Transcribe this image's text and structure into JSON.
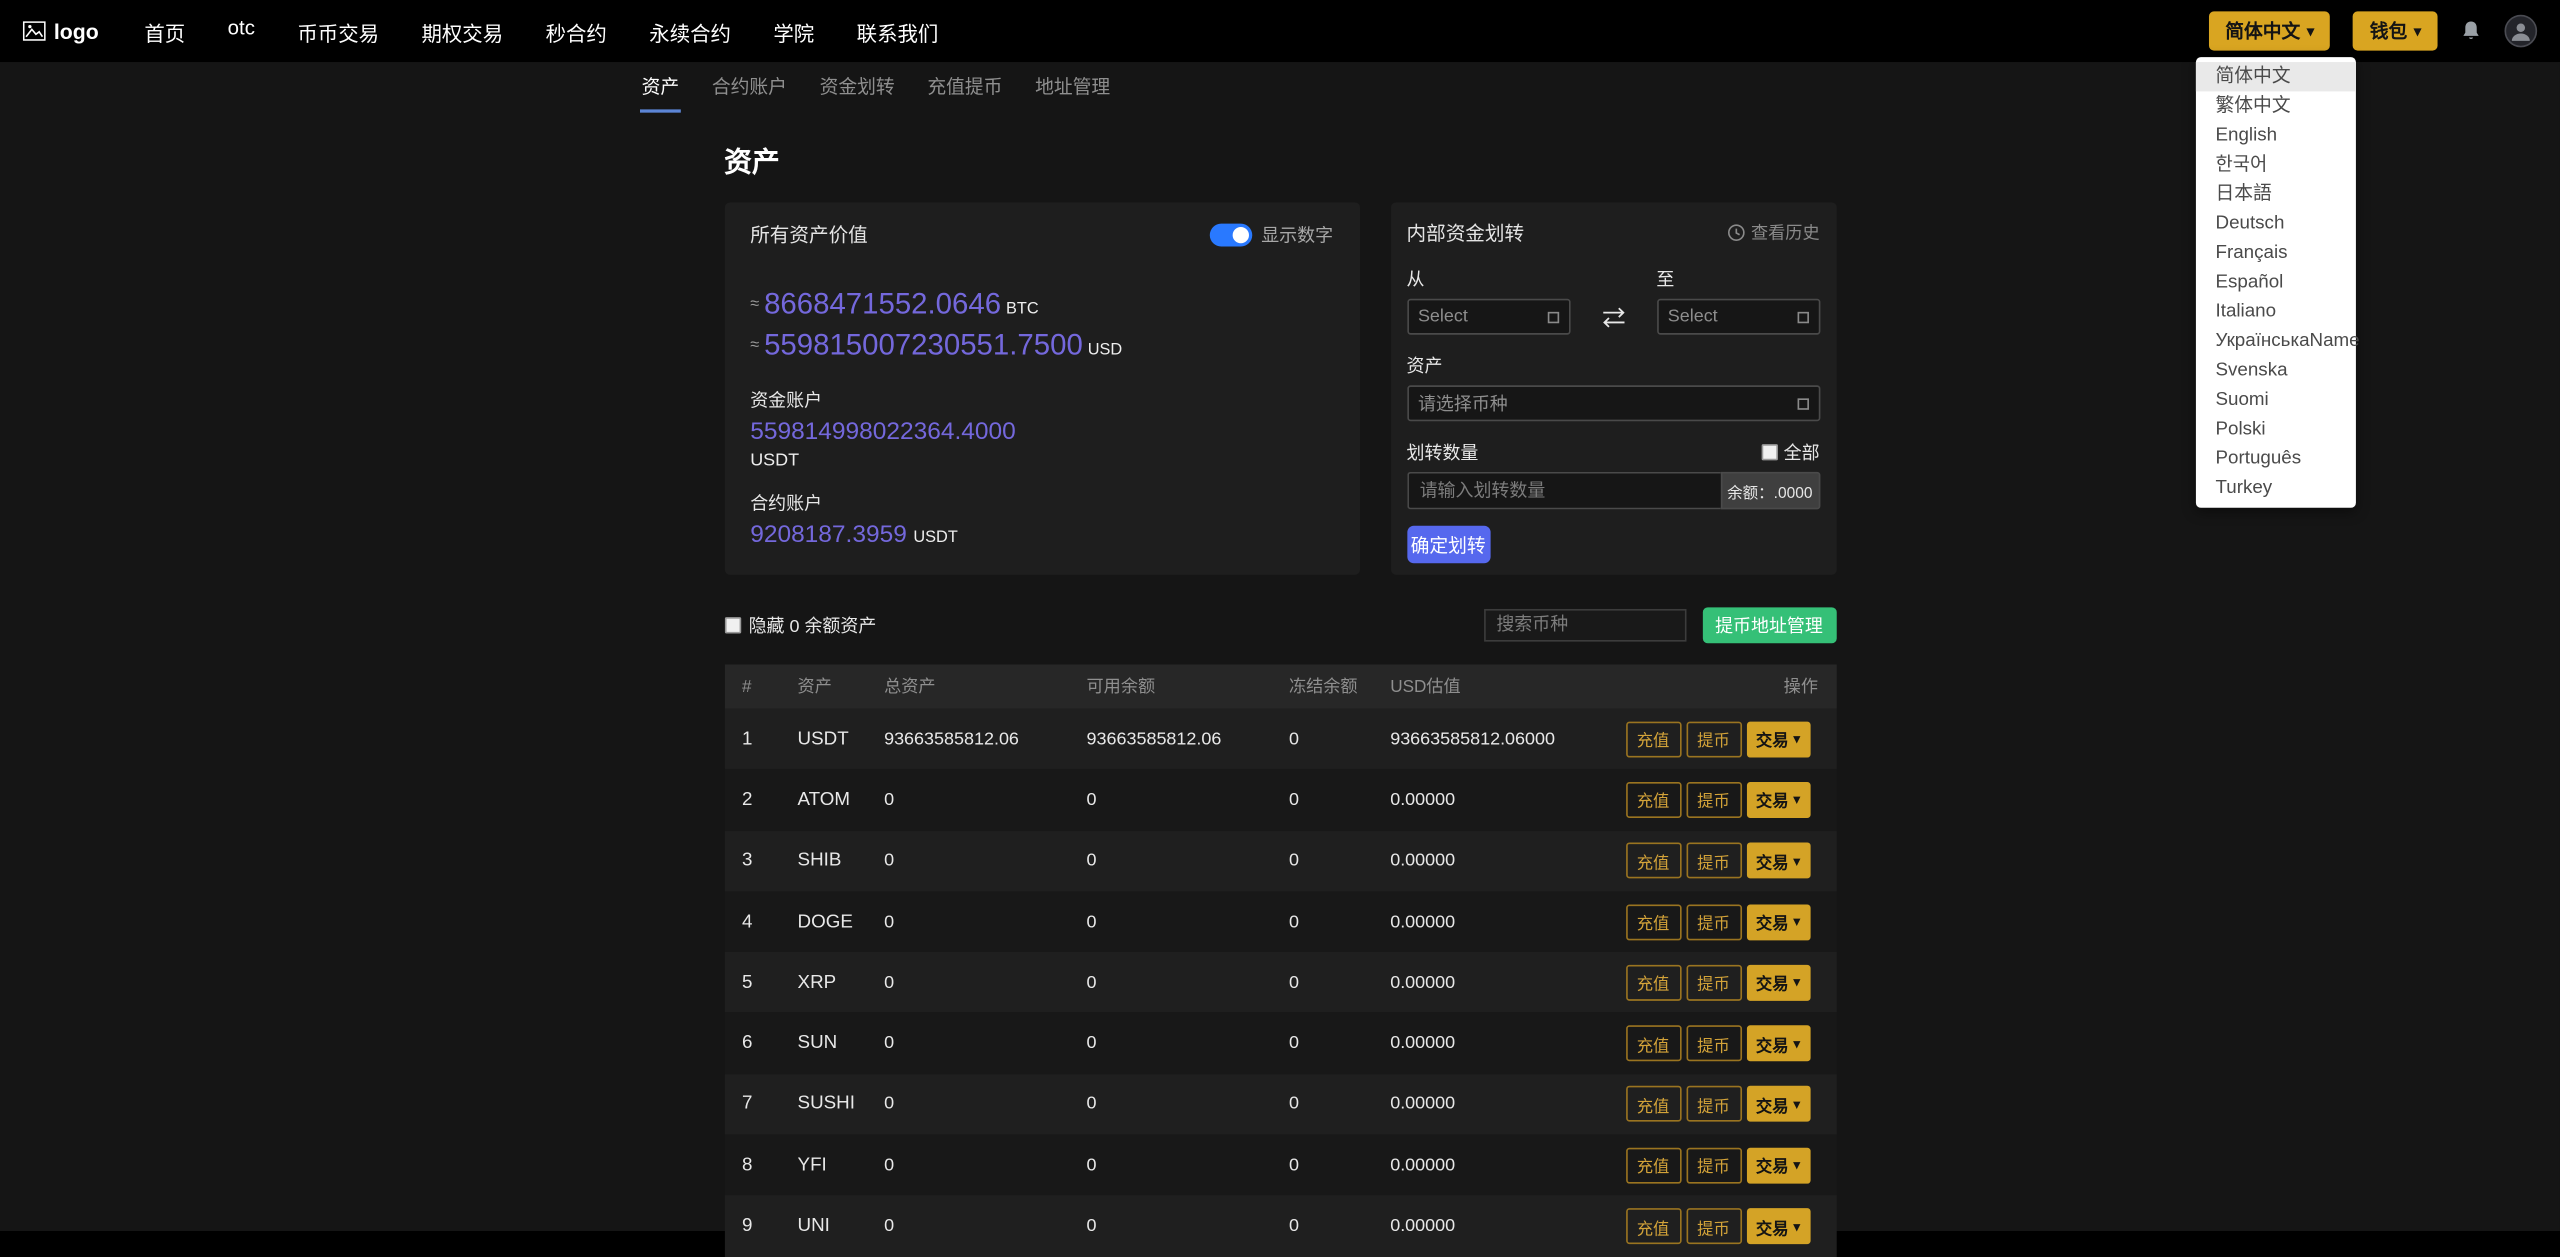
{
  "colors": {
    "accent_yellow": "#d9a521",
    "accent_purple": "#7468dc",
    "accent_green": "#35c077",
    "accent_blue": "#5668ee",
    "toggle_blue": "#2979ff"
  },
  "navbar": {
    "logo_text": "logo",
    "items": [
      "首页",
      "otc",
      "币币交易",
      "期权交易",
      "秒合约",
      "永续合约",
      "学院",
      "联系我们"
    ],
    "language_button": "简体中文",
    "wallet_button": "钱包"
  },
  "language_menu": {
    "selected": "简体中文",
    "items": [
      "简体中文",
      "繁体中文",
      "English",
      "한국어",
      "日本語",
      "Deutsch",
      "Français",
      "Español",
      "Italiano",
      "УкраїнськаName",
      "Svenska",
      "Suomi",
      "Polski",
      "Português",
      "Turkey"
    ]
  },
  "subnav": {
    "tabs": [
      {
        "label": "资产",
        "active": true
      },
      {
        "label": "合约账户",
        "active": false
      },
      {
        "label": "资金划转",
        "active": false
      },
      {
        "label": "充值提币",
        "active": false
      },
      {
        "label": "地址管理",
        "active": false
      }
    ]
  },
  "page": {
    "title": "资产"
  },
  "assets_panel": {
    "title": "所有资产价值",
    "toggle_label": "显示数字",
    "approx_symbol": "≈",
    "btc_value": "8668471552.0646",
    "btc_unit": "BTC",
    "usd_value": "559815007230551.7500",
    "usd_unit": "USD",
    "fund_account_label": "资金账户",
    "fund_account_value": "559814998022364.4000",
    "fund_account_unit": "USDT",
    "contract_account_label": "合约账户",
    "contract_account_value": "9208187.3959",
    "contract_account_unit": "USDT"
  },
  "transfer_panel": {
    "title": "内部资金划转",
    "history_label": "查看历史",
    "from_label": "从",
    "to_label": "至",
    "from_placeholder": "Select",
    "to_placeholder": "Select",
    "asset_label": "资产",
    "asset_placeholder": "请选择币种",
    "amount_label": "划转数量",
    "all_label": "全部",
    "amount_placeholder": "请输入划转数量",
    "balance_label": "余额：.0000",
    "submit_label": "确定划转"
  },
  "filters": {
    "hide_zero_label": "隐藏 0 余额资产",
    "search_placeholder": "搜索币种",
    "address_button": "提币地址管理"
  },
  "table": {
    "headers": [
      "#",
      "资产",
      "总资产",
      "可用余额",
      "冻结余额",
      "USD估值",
      "操作"
    ],
    "action_labels": {
      "deposit": "充值",
      "withdraw": "提币",
      "trade": "交易"
    },
    "rows": [
      {
        "idx": "1",
        "asset": "USDT",
        "total": "93663585812.06",
        "available": "93663585812.06",
        "frozen": "0",
        "usd": "93663585812.06000"
      },
      {
        "idx": "2",
        "asset": "ATOM",
        "total": "0",
        "available": "0",
        "frozen": "0",
        "usd": "0.00000"
      },
      {
        "idx": "3",
        "asset": "SHIB",
        "total": "0",
        "available": "0",
        "frozen": "0",
        "usd": "0.00000"
      },
      {
        "idx": "4",
        "asset": "DOGE",
        "total": "0",
        "available": "0",
        "frozen": "0",
        "usd": "0.00000"
      },
      {
        "idx": "5",
        "asset": "XRP",
        "total": "0",
        "available": "0",
        "frozen": "0",
        "usd": "0.00000"
      },
      {
        "idx": "6",
        "asset": "SUN",
        "total": "0",
        "available": "0",
        "frozen": "0",
        "usd": "0.00000"
      },
      {
        "idx": "7",
        "asset": "SUSHI",
        "total": "0",
        "available": "0",
        "frozen": "0",
        "usd": "0.00000"
      },
      {
        "idx": "8",
        "asset": "YFI",
        "total": "0",
        "available": "0",
        "frozen": "0",
        "usd": "0.00000"
      },
      {
        "idx": "9",
        "asset": "UNI",
        "total": "0",
        "available": "0",
        "frozen": "0",
        "usd": "0.00000"
      }
    ]
  }
}
